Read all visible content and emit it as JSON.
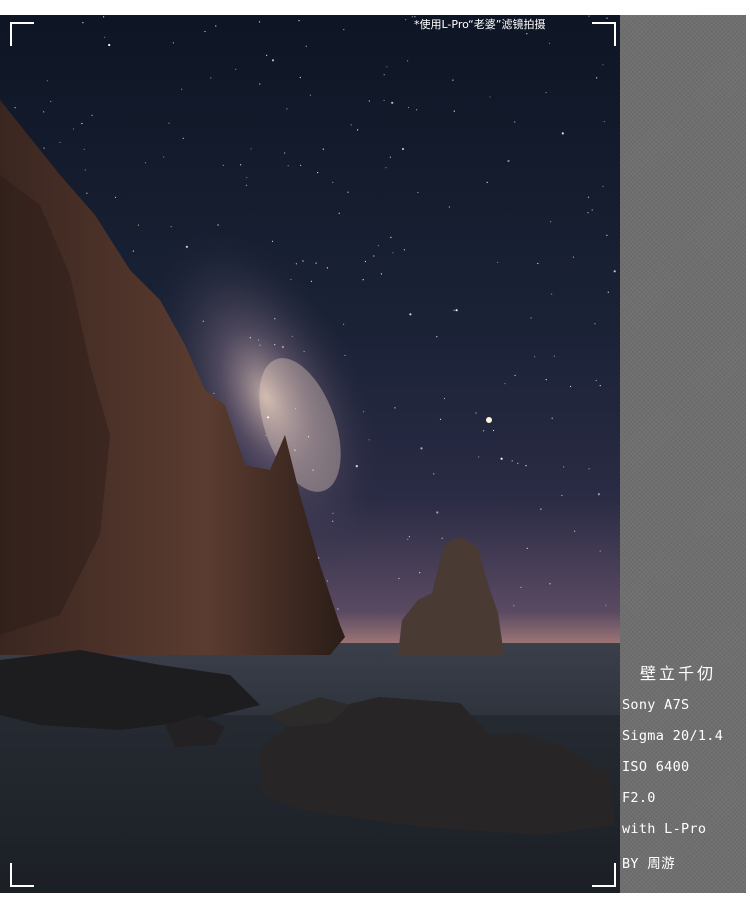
{
  "photo": {
    "description_icon": "milky-way-seascape-photo"
  },
  "note": "*使用L-Pro“老婆”滤镜拍摄",
  "caption": {
    "title": "壁立千仞",
    "lines": [
      "Sony A7S",
      "Sigma 20/1.4",
      "ISO 6400",
      "F2.0",
      "with L-Pro",
      "BY 周游"
    ]
  },
  "colors": {
    "panel": "#6f6f6f",
    "sky_top": "#0f1626",
    "horizon_glow": "#c48a6a"
  }
}
